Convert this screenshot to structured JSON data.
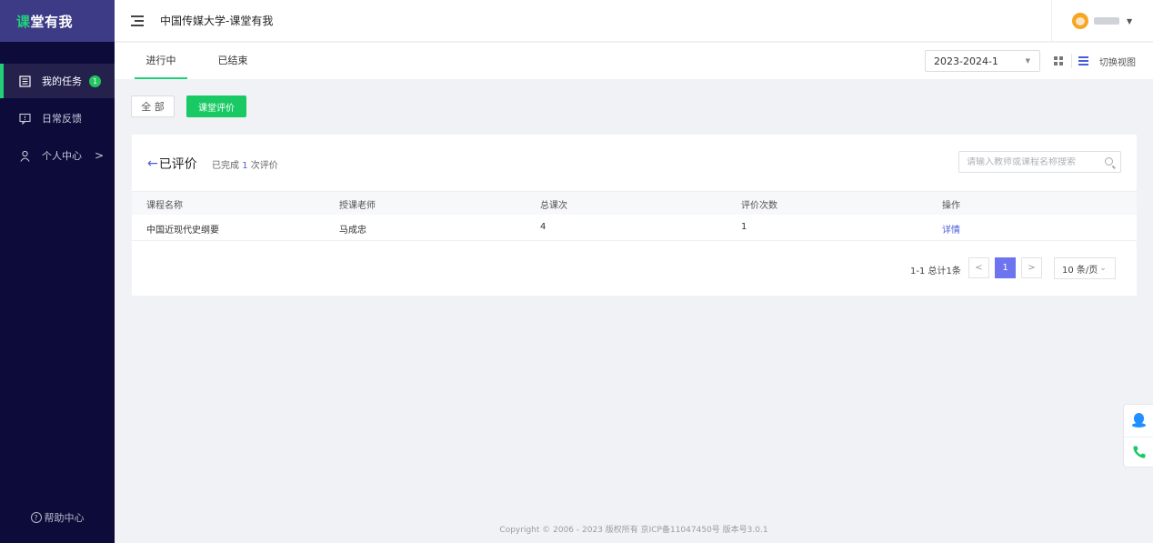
{
  "app": {
    "logo_accent": "课",
    "logo_rest": "堂有我",
    "title": "中国传媒大学-课堂有我"
  },
  "sidebar": {
    "items": [
      {
        "label": "我的任务",
        "badge": "1"
      },
      {
        "label": "日常反馈"
      },
      {
        "label": "个人中心",
        "chevron": ">"
      }
    ],
    "help_label": "帮助中心",
    "help_icon_glyph": "?"
  },
  "tabs": {
    "items": [
      {
        "label": "进行中"
      },
      {
        "label": "已结束"
      }
    ]
  },
  "toolbar": {
    "term": "2023-2024-1",
    "view_switch_label": "切换视图"
  },
  "filters": {
    "all_label": "全 部",
    "eval_label": "课堂评价"
  },
  "card": {
    "back_label": "已评价",
    "done_prefix": "已完成",
    "done_count": "1",
    "done_suffix": "次评价",
    "search_placeholder": "请输入教师或课程名称搜索"
  },
  "table": {
    "headers": [
      "课程名称",
      "授课老师",
      "总课次",
      "评价次数",
      "操作"
    ],
    "rows": [
      {
        "course": "中国近现代史纲要",
        "teacher": "马成忠",
        "total": "4",
        "evaluations": "1",
        "action": "详情"
      }
    ]
  },
  "pager": {
    "total_text": "1-1 总计1条",
    "current_page": "1",
    "page_size": "10 条/页",
    "prev_glyph": "<",
    "next_glyph": ">"
  },
  "footer": {
    "text": "Copyright © 2006 - 2023 版权所有 京ICP备11047450号 版本号3.0.1"
  },
  "colors": {
    "sidebar_bg": "#0d0b3a",
    "accent_green": "#22d07a",
    "primary_blue": "#4b5cdb",
    "pager_active": "#6c74f0"
  },
  "icons": {
    "menu_task": "clipboard-list-icon",
    "menu_feedback": "comment-icon",
    "menu_profile": "user-icon",
    "help": "question-circle-icon",
    "float_qq": "qq-icon",
    "float_phone": "phone-icon"
  }
}
